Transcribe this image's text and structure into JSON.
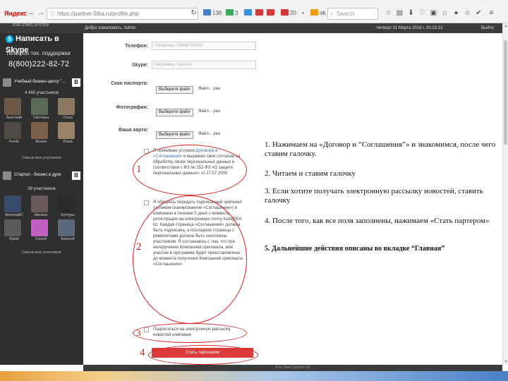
{
  "browser": {
    "logo": "Яндекс",
    "url": "https://partner.56ta.ru/profile.php",
    "search_placeholder": "Search",
    "extensions": [
      {
        "label": "136",
        "color": "#4a7fc1"
      },
      {
        "label": "3",
        "color": "#3aa860"
      },
      {
        "label": "",
        "color": "#3a8fd8"
      },
      {
        "label": "",
        "color": "#d23b3b"
      },
      {
        "label": "",
        "color": "#d23b3b"
      },
      {
        "label": "20",
        "color": "#d23b3b"
      },
      {
        "label": "•",
        "color": "#777777"
      },
      {
        "label": "ok",
        "color": "#f39c12"
      }
    ]
  },
  "site": {
    "brand": "FIVE STARS SYSTEM",
    "welcome": "Добро пожаловать, Admin",
    "today": "Четверг 31 Марта 2016 г. 20:23:13",
    "logout": "Выйти"
  },
  "sidebar": {
    "skype_title": "Написать в Skype",
    "phone_label": "Телефон тех. поддержки",
    "phone": "8(800)222-82-72",
    "centers": [
      {
        "title": "Учебный бизнес-центр \"...",
        "badge": "B",
        "count": "4 450 участников",
        "members": [
          {
            "name": "Анатолий",
            "color": "#6b5a4a"
          },
          {
            "name": "Светлана",
            "color": "#5a6a55"
          },
          {
            "name": "Ольга",
            "color": "#8a7a62"
          },
          {
            "name": "Fenda",
            "color": "#4f4a44"
          },
          {
            "name": "Жанна",
            "color": "#7a6048"
          },
          {
            "name": "Ольга",
            "color": "#9a8268"
          }
        ],
        "all_link": "Список всех участников"
      },
      {
        "title": "Стартап - бизнес в духе",
        "badge": "B",
        "count": "39 участников",
        "members": [
          {
            "name": "АнатолийС",
            "color": "#3a4a6a"
          },
          {
            "name": "Милана",
            "color": "#6a5a5a"
          },
          {
            "name": "Културы",
            "color": "#2a2a2a"
          },
          {
            "name": "Юрий",
            "color": "#5a5a5a"
          },
          {
            "name": "Сергей",
            "color": "#c060c0"
          },
          {
            "name": "Алексей",
            "color": "#5a6a7a"
          }
        ],
        "all_link": "Список всех участников"
      }
    ]
  },
  "form": {
    "phone_label": "Телефон:",
    "phone_placeholder": "Например, 89998765433",
    "skype_label": "Skype:",
    "skype_placeholder": "Например, Ivanov4",
    "passport_label": "Скан паспорта:",
    "photo_label": "Фотография:",
    "card_label": "Ваша карта:",
    "file_button": "Выберите файл",
    "file_none": "Файл... рен",
    "consent1_prefix": "Я принимаю условия ",
    "consent1_link1": "Договора",
    "consent1_mid": " и ",
    "consent1_link2": "«Соглашения»",
    "consent1_rest": " и выражаю свое согласие на обработку своих персональных данных в соответствии с ФЗ № 152-ФЗ «О защите персональных данных» от 27.07.2006",
    "consent2_text": "Я обязуюсь передать подписанный оригинал (целиком сканированное «Соглашение») в компанию в течение 5 дней с момента регистрации на электронную почту Isub@5% lst. Каждая страница «Соглашения» должна быть подписана, а последняя страница с реквизитами должна быть заполнена участником. Я соглашаюсь с тем, что при непоручении Компанией оригинала, моё участие в программе будет приостановлено до момента получения Компанией оригинала «Соглашения»",
    "consent3_text": "Подписаться на электронную рассылку новостей компании",
    "submit_label": "Стать партнером"
  },
  "annotations": {
    "numbers": [
      "1",
      "2",
      "3",
      "4"
    ],
    "steps": [
      "1. Нажимаем на «Договор и “Соглашения”» и знакомимся, после чего ставим галочку.",
      "2. Читаем и ставим галочку",
      "3. Если хотите получать электронную рассылку новостей, ставить галочку",
      "4. После того, как все поля заполнены, нажимаем «Стать партером»",
      "5. Дальнейшие действия описаны во вкладке “Главная”"
    ]
  },
  "footer": {
    "text": "Five Stars System Ltd"
  }
}
